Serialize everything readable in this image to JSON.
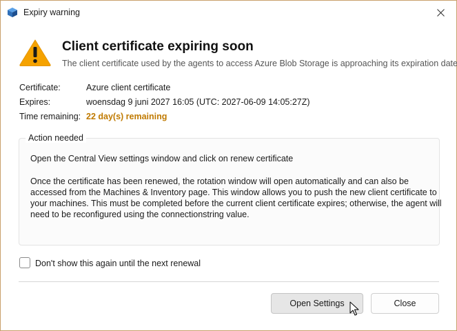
{
  "window": {
    "title": "Expiry warning",
    "app_icon": "cube-icon",
    "close_icon": "close-icon"
  },
  "header": {
    "icon": "warning-icon",
    "accent_color": "#f5a200",
    "title": "Client certificate expiring soon",
    "subtitle": "The client certificate used by the agents to access Azure Blob Storage is approaching its expiration date"
  },
  "details": {
    "certificate_label": "Certificate:",
    "certificate_value": "Azure client certificate",
    "expires_label": "Expires:",
    "expires_value": "woensdag 9 juni 2027 16:05 (UTC: 2027-06-09 14:05:27Z)",
    "remaining_label": "Time remaining:",
    "remaining_value": "22 day(s) remaining",
    "remaining_color": "#c07a00"
  },
  "action": {
    "legend": "Action needed",
    "line1": "Open the Central View settings window and click on renew certificate",
    "para_lines": [
      "Once the certificate has been renewed, the rotation window will open automatically and can also be",
      "accessed from the Machines & Inventory page. This window allows you to push the new client certificate to",
      "your machines. This must be completed before the current client certificate expires; otherwise, the agent will",
      "need to be reconfigured using the connectionstring value."
    ]
  },
  "options": {
    "dont_show_label": "Don't show this again until the next renewal",
    "dont_show_checked": false
  },
  "buttons": {
    "open_settings": "Open Settings",
    "close": "Close"
  }
}
